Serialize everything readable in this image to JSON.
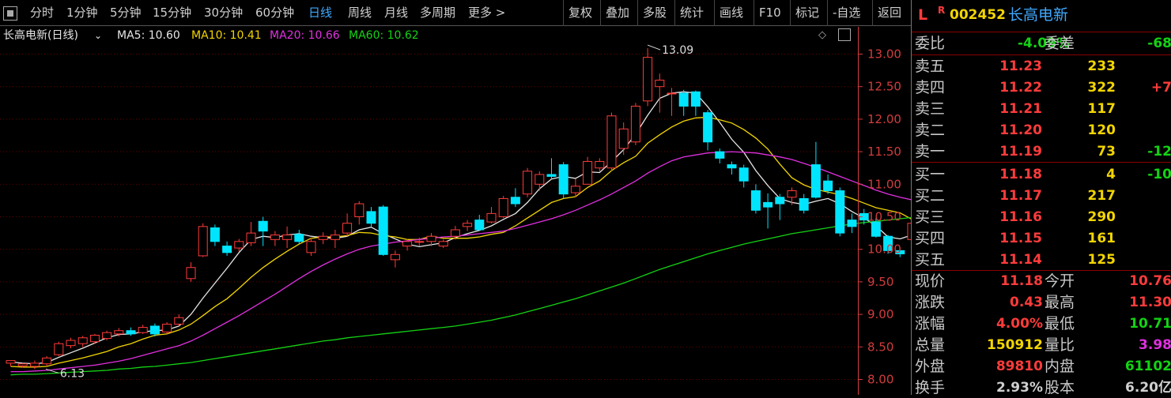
{
  "toolbar": {
    "periods": [
      {
        "label": "分时",
        "active": false
      },
      {
        "label": "1分钟",
        "active": false
      },
      {
        "label": "5分钟",
        "active": false
      },
      {
        "label": "15分钟",
        "active": false
      },
      {
        "label": "30分钟",
        "active": false
      },
      {
        "label": "60分钟",
        "active": false
      },
      {
        "label": "日线",
        "active": true
      },
      {
        "label": "周线",
        "active": false
      },
      {
        "label": "月线",
        "active": false
      },
      {
        "label": "多周期",
        "active": false
      },
      {
        "label": "更多 >",
        "active": false
      }
    ],
    "tools": [
      "复权",
      "叠加",
      "多股",
      "统计",
      "画线",
      "F10",
      "标记",
      "-自选",
      "返回"
    ]
  },
  "chart_header": {
    "title": "长高电新(日线)",
    "ma5": "MA5: 10.60",
    "ma10": "MA10: 10.41",
    "ma20": "MA20: 10.66",
    "ma60": "MA60: 10.62"
  },
  "colors": {
    "up": "#ff3b3b",
    "down": "#00e5ff",
    "ma5": "#e6e6e6",
    "ma10": "#f2d500",
    "ma20": "#e030e0",
    "ma60": "#14d214",
    "grid": "#6b0000",
    "axis": "#d23c3c"
  },
  "chart_data": {
    "type": "candlestick",
    "title": "长高电新(日线)",
    "y_ticks": [
      "13.00",
      "12.50",
      "12.00",
      "11.50",
      "11.00",
      "10.50",
      "10.00",
      "9.50",
      "9.00",
      "8.50",
      "8.00"
    ],
    "ylim": [
      8.0,
      13.0
    ],
    "high_label": "13.09",
    "low_label": "6.13",
    "candles": [
      [
        8.25,
        8.29,
        8.28,
        8.2
      ],
      [
        8.21,
        8.24,
        8.25,
        8.18
      ],
      [
        8.2,
        8.25,
        8.29,
        8.16
      ],
      [
        8.24,
        8.33,
        8.36,
        8.21
      ],
      [
        8.38,
        8.55,
        8.58,
        8.36
      ],
      [
        8.52,
        8.6,
        8.64,
        8.48
      ],
      [
        8.55,
        8.64,
        8.67,
        8.5
      ],
      [
        8.58,
        8.68,
        8.7,
        8.55
      ],
      [
        8.63,
        8.72,
        8.75,
        8.6
      ],
      [
        8.7,
        8.75,
        8.79,
        8.66
      ],
      [
        8.75,
        8.7,
        8.8,
        8.67
      ],
      [
        8.72,
        8.8,
        8.84,
        8.7
      ],
      [
        8.82,
        8.7,
        8.86,
        8.66
      ],
      [
        8.73,
        8.85,
        8.88,
        8.7
      ],
      [
        8.85,
        8.95,
        9.0,
        8.82
      ],
      [
        9.55,
        9.72,
        9.8,
        9.5
      ],
      [
        9.9,
        10.35,
        10.4,
        9.88
      ],
      [
        10.33,
        10.12,
        10.38,
        10.05
      ],
      [
        10.05,
        9.95,
        10.12,
        9.9
      ],
      [
        10.02,
        10.12,
        10.16,
        9.96
      ],
      [
        10.1,
        10.25,
        10.42,
        10.05
      ],
      [
        10.43,
        10.28,
        10.5,
        10.05
      ],
      [
        10.15,
        10.22,
        10.28,
        10.05
      ],
      [
        10.15,
        10.22,
        10.35,
        10.02
      ],
      [
        10.23,
        10.12,
        10.3,
        10.08
      ],
      [
        9.95,
        10.12,
        10.18,
        9.9
      ],
      [
        10.15,
        10.2,
        10.26,
        10.08
      ],
      [
        10.15,
        10.22,
        10.3,
        10.02
      ],
      [
        10.25,
        10.4,
        10.55,
        10.2
      ],
      [
        10.5,
        10.7,
        10.74,
        10.38
      ],
      [
        10.58,
        10.4,
        10.65,
        10.35
      ],
      [
        10.65,
        9.92,
        10.68,
        9.9
      ],
      [
        9.84,
        9.92,
        9.98,
        9.72
      ],
      [
        10.05,
        10.12,
        10.16,
        9.98
      ],
      [
        10.12,
        10.12,
        10.18,
        10.05
      ],
      [
        10.12,
        10.2,
        10.25,
        10.05
      ],
      [
        10.05,
        10.12,
        10.15,
        10.02
      ],
      [
        10.2,
        10.3,
        10.36,
        10.15
      ],
      [
        10.35,
        10.4,
        10.45,
        10.28
      ],
      [
        10.45,
        10.3,
        10.53,
        10.28
      ],
      [
        10.42,
        10.55,
        10.65,
        10.4
      ],
      [
        10.5,
        10.78,
        10.82,
        10.48
      ],
      [
        10.8,
        10.7,
        10.94,
        10.65
      ],
      [
        10.85,
        11.2,
        11.25,
        10.8
      ],
      [
        11.0,
        11.15,
        11.2,
        10.9
      ],
      [
        11.15,
        11.12,
        11.4,
        11.08
      ],
      [
        11.3,
        10.85,
        11.34,
        10.78
      ],
      [
        10.87,
        10.97,
        11.08,
        10.8
      ],
      [
        11.0,
        11.35,
        11.42,
        11.0
      ],
      [
        11.25,
        11.35,
        11.4,
        11.2
      ],
      [
        11.25,
        12.05,
        12.1,
        11.2
      ],
      [
        11.55,
        11.85,
        11.95,
        11.45
      ],
      [
        11.65,
        12.2,
        12.25,
        11.6
      ],
      [
        12.28,
        12.95,
        13.09,
        12.2
      ],
      [
        12.5,
        12.6,
        12.7,
        12.1
      ],
      [
        12.4,
        12.4,
        12.48,
        12.05
      ],
      [
        12.4,
        12.2,
        12.45,
        12.05
      ],
      [
        12.42,
        12.2,
        12.44,
        12.05
      ],
      [
        12.1,
        11.65,
        12.14,
        11.52
      ],
      [
        11.5,
        11.4,
        11.55,
        11.32
      ],
      [
        11.3,
        11.25,
        11.35,
        11.15
      ],
      [
        11.25,
        11.05,
        11.3,
        10.95
      ],
      [
        10.9,
        10.6,
        11.0,
        10.55
      ],
      [
        10.72,
        10.65,
        10.86,
        10.32
      ],
      [
        10.8,
        10.7,
        10.85,
        10.45
      ],
      [
        10.8,
        10.9,
        10.95,
        10.68
      ],
      [
        10.78,
        10.6,
        10.85,
        10.55
      ],
      [
        11.3,
        10.8,
        11.65,
        10.78
      ],
      [
        11.05,
        10.9,
        11.15,
        10.85
      ],
      [
        10.9,
        10.25,
        10.95,
        10.2
      ],
      [
        10.45,
        10.35,
        10.55,
        10.25
      ],
      [
        10.55,
        10.45,
        10.62,
        10.38
      ],
      [
        10.42,
        10.2,
        10.48,
        10.18
      ],
      [
        10.2,
        9.98,
        10.22,
        9.93
      ],
      [
        9.98,
        9.93,
        10.0,
        9.88
      ],
      [
        10.15,
        10.4,
        10.55,
        10.12
      ],
      [
        10.45,
        10.52,
        10.6,
        10.4
      ],
      [
        10.48,
        10.5,
        10.55,
        10.4
      ],
      [
        10.35,
        10.28,
        10.4,
        10.2
      ],
      [
        10.45,
        10.7,
        10.75,
        10.4
      ],
      [
        10.8,
        11.18,
        11.3,
        10.71
      ]
    ],
    "series": [
      {
        "name": "MA5",
        "values": [
          8.27,
          8.25,
          8.24,
          8.26,
          8.34,
          8.41,
          8.48,
          8.56,
          8.64,
          8.69,
          8.7,
          8.73,
          8.75,
          8.76,
          8.82,
          9.0,
          9.25,
          9.48,
          9.71,
          9.95,
          10.15,
          10.2,
          10.18,
          10.22,
          10.24,
          10.2,
          10.18,
          10.17,
          10.2,
          10.3,
          10.34,
          10.24,
          10.16,
          10.08,
          10.04,
          10.07,
          10.1,
          10.18,
          10.24,
          10.29,
          10.36,
          10.46,
          10.55,
          10.72,
          10.93,
          11.08,
          11.12,
          11.09,
          11.19,
          11.18,
          11.35,
          11.53,
          11.77,
          12.06,
          12.32,
          12.4,
          12.42,
          12.4,
          12.19,
          11.95,
          11.69,
          11.49,
          11.21,
          10.98,
          10.78,
          10.72,
          10.69,
          10.74,
          10.78,
          10.7,
          10.58,
          10.48,
          10.36,
          10.19,
          10.16,
          10.22,
          10.31,
          10.37,
          10.44,
          10.56,
          10.64
        ]
      },
      {
        "name": "MA10",
        "values": [
          8.2,
          8.19,
          8.19,
          8.2,
          8.25,
          8.29,
          8.33,
          8.38,
          8.43,
          8.5,
          8.55,
          8.62,
          8.68,
          8.7,
          8.76,
          8.85,
          8.98,
          9.12,
          9.24,
          9.4,
          9.57,
          9.72,
          9.85,
          9.97,
          10.08,
          10.17,
          10.19,
          10.19,
          10.21,
          10.26,
          10.25,
          10.21,
          10.19,
          10.15,
          10.15,
          10.2,
          10.17,
          10.17,
          10.17,
          10.19,
          10.23,
          10.26,
          10.36,
          10.48,
          10.6,
          10.72,
          10.78,
          10.81,
          10.95,
          11.05,
          11.21,
          11.33,
          11.43,
          11.63,
          11.76,
          11.88,
          11.97,
          12.02,
          12.03,
          11.99,
          11.94,
          11.84,
          11.71,
          11.54,
          11.31,
          11.1,
          10.99,
          10.92,
          10.88,
          10.84,
          10.78,
          10.71,
          10.64,
          10.6,
          10.56,
          10.46,
          10.38,
          10.36,
          10.38,
          10.4,
          10.41
        ]
      },
      {
        "name": "MA20",
        "values": [
          8.12,
          8.12,
          8.13,
          8.14,
          8.16,
          8.18,
          8.2,
          8.22,
          8.25,
          8.28,
          8.32,
          8.37,
          8.42,
          8.47,
          8.52,
          8.59,
          8.68,
          8.78,
          8.88,
          8.98,
          9.09,
          9.2,
          9.31,
          9.43,
          9.55,
          9.66,
          9.76,
          9.85,
          9.93,
          10.0,
          10.05,
          10.08,
          10.11,
          10.13,
          10.15,
          10.17,
          10.19,
          10.2,
          10.22,
          10.24,
          10.26,
          10.28,
          10.32,
          10.37,
          10.42,
          10.47,
          10.53,
          10.6,
          10.68,
          10.76,
          10.85,
          10.95,
          11.05,
          11.17,
          11.27,
          11.36,
          11.42,
          11.45,
          11.48,
          11.49,
          11.5,
          11.49,
          11.48,
          11.45,
          11.42,
          11.38,
          11.32,
          11.26,
          11.19,
          11.12,
          11.05,
          10.98,
          10.91,
          10.85,
          10.8,
          10.76,
          10.72,
          10.69,
          10.67,
          10.66,
          10.66
        ]
      },
      {
        "name": "MA60",
        "values": [
          8.07,
          8.08,
          8.08,
          8.09,
          8.1,
          8.11,
          8.12,
          8.13,
          8.14,
          8.16,
          8.17,
          8.19,
          8.2,
          8.22,
          8.24,
          8.26,
          8.29,
          8.32,
          8.35,
          8.38,
          8.41,
          8.44,
          8.47,
          8.5,
          8.53,
          8.56,
          8.59,
          8.61,
          8.64,
          8.66,
          8.68,
          8.7,
          8.72,
          8.74,
          8.76,
          8.78,
          8.8,
          8.82,
          8.85,
          8.88,
          8.91,
          8.95,
          8.99,
          9.04,
          9.09,
          9.14,
          9.19,
          9.24,
          9.3,
          9.36,
          9.42,
          9.48,
          9.55,
          9.62,
          9.69,
          9.75,
          9.81,
          9.87,
          9.93,
          9.98,
          10.03,
          10.08,
          10.12,
          10.16,
          10.2,
          10.24,
          10.27,
          10.3,
          10.33,
          10.36,
          10.39,
          10.41,
          10.43,
          10.45,
          10.47,
          10.49,
          10.51,
          10.54,
          10.57,
          10.6,
          10.62
        ]
      }
    ]
  },
  "quote": {
    "prefix_l": "L",
    "prefix_r": "R",
    "code": "002452",
    "name": "长高电新",
    "weibi_label": "委比",
    "weibi_value": "-4.09%",
    "weicha_label": "委差",
    "weicha_value": "-68",
    "asks": [
      {
        "label": "卖五",
        "price": "11.23",
        "vol": "233",
        "chg": ""
      },
      {
        "label": "卖四",
        "price": "11.22",
        "vol": "322",
        "chg": "+7"
      },
      {
        "label": "卖三",
        "price": "11.21",
        "vol": "117",
        "chg": ""
      },
      {
        "label": "卖二",
        "price": "11.20",
        "vol": "120",
        "chg": ""
      },
      {
        "label": "卖一",
        "price": "11.19",
        "vol": "73",
        "chg": "-12"
      }
    ],
    "bids": [
      {
        "label": "买一",
        "price": "11.18",
        "vol": "4",
        "chg": "-10"
      },
      {
        "label": "买二",
        "price": "11.17",
        "vol": "217",
        "chg": ""
      },
      {
        "label": "买三",
        "price": "11.16",
        "vol": "290",
        "chg": ""
      },
      {
        "label": "买四",
        "price": "11.15",
        "vol": "161",
        "chg": ""
      },
      {
        "label": "买五",
        "price": "11.14",
        "vol": "125",
        "chg": ""
      }
    ],
    "stats": [
      {
        "l1": "现价",
        "v1": "11.18",
        "c1": "#ff3b3b",
        "l2": "今开",
        "v2": "10.76",
        "c2": "#ff3b3b"
      },
      {
        "l1": "涨跌",
        "v1": "0.43",
        "c1": "#ff3b3b",
        "l2": "最高",
        "v2": "11.30",
        "c2": "#ff3b3b"
      },
      {
        "l1": "涨幅",
        "v1": "4.00%",
        "c1": "#ff3b3b",
        "l2": "最低",
        "v2": "10.71",
        "c2": "#14d214"
      },
      {
        "l1": "总量",
        "v1": "150912",
        "c1": "#f2d500",
        "l2": "量比",
        "v2": "3.98",
        "c2": "#e030e0"
      },
      {
        "l1": "外盘",
        "v1": "89810",
        "c1": "#ff3b3b",
        "l2": "内盘",
        "v2": "61102",
        "c2": "#14d214"
      },
      {
        "l1": "换手",
        "v1": "2.93%",
        "c1": "#d0d0d0",
        "l2": "股本",
        "v2": "6.20亿",
        "c2": "#d0d0d0"
      }
    ]
  }
}
